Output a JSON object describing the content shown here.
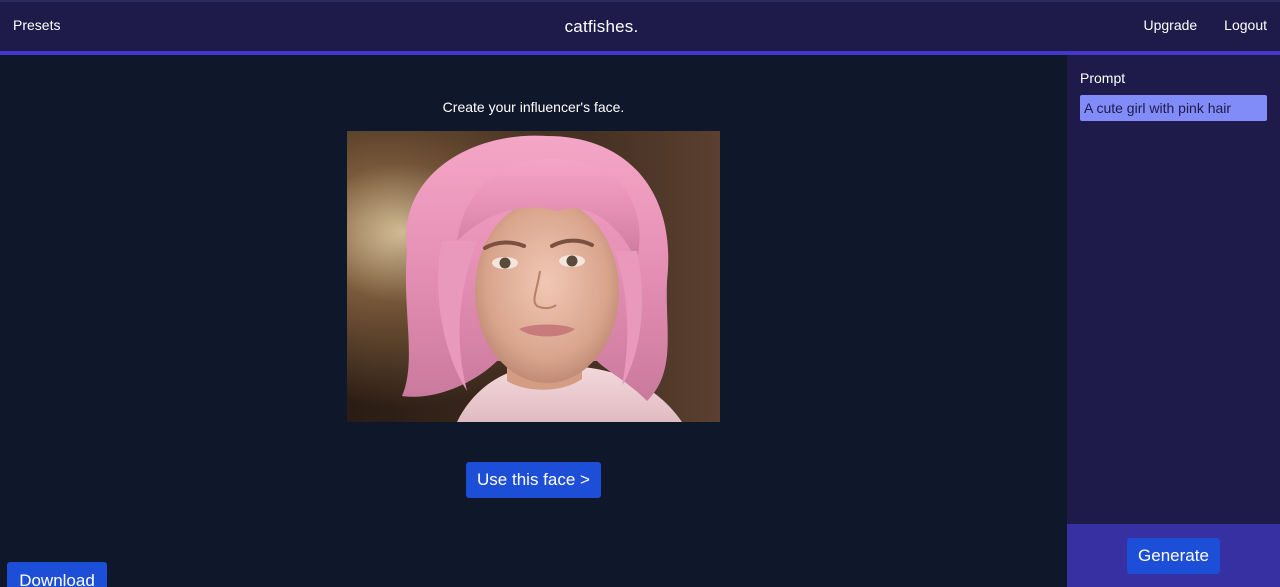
{
  "header": {
    "presets_label": "Presets",
    "brand": "catfishes.",
    "upgrade_label": "Upgrade",
    "logout_label": "Logout"
  },
  "main": {
    "subtitle": "Create your influencer's face.",
    "use_face_label": "Use this face >",
    "download_label": "Download"
  },
  "sidebar": {
    "prompt_label": "Prompt",
    "prompt_value": "A cute girl with pink hair",
    "generate_label": "Generate"
  },
  "colors": {
    "header_bg": "#1e1b4b",
    "header_accent": "#4338ca",
    "main_bg": "#0f172a",
    "sidebar_bg": "#1e1b4b",
    "sidebar_footer_bg": "#3730a3",
    "button_bg": "#1d4ed8",
    "input_bg": "#818cf8"
  }
}
